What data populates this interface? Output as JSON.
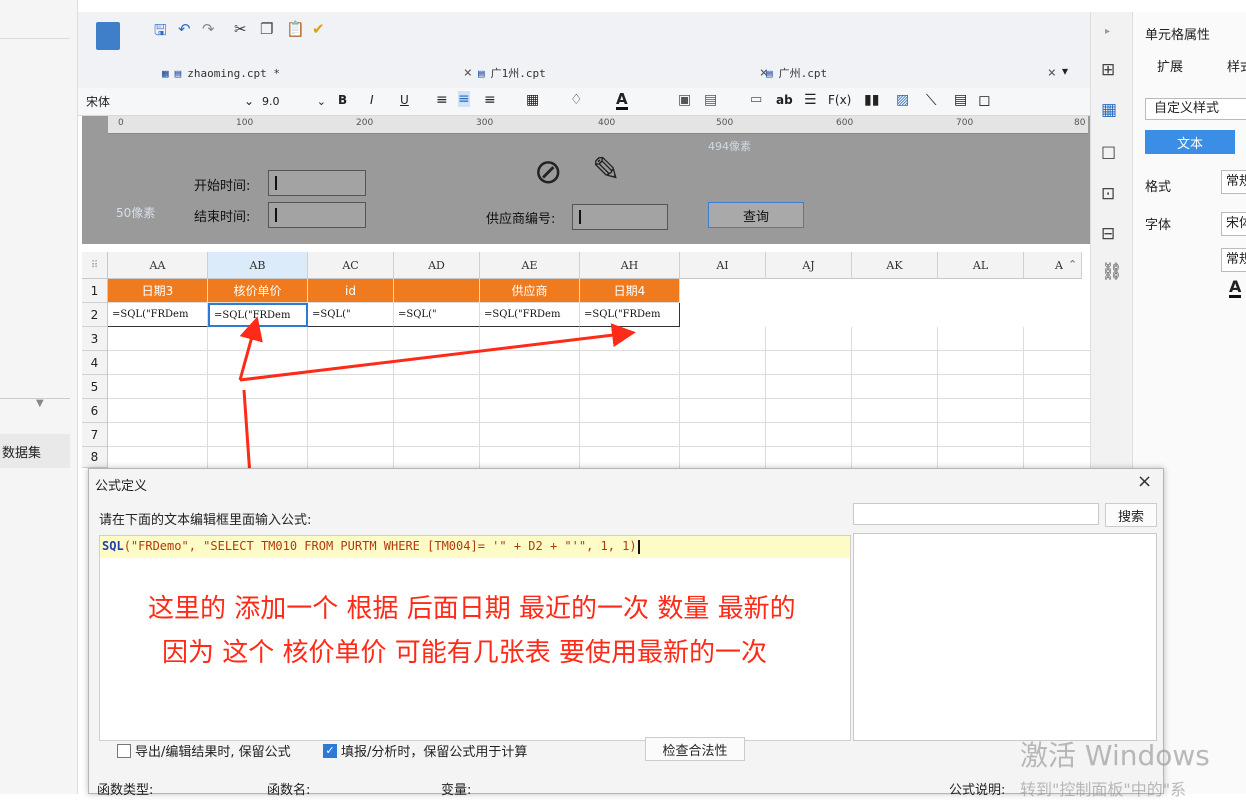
{
  "left_panel": {
    "dataset_label": "数据集"
  },
  "toolbar": {
    "tabs": [
      {
        "icon": "grid-icon",
        "label": "zhaoming.cpt *"
      },
      {
        "label": "广1州.cpt"
      },
      {
        "label": "广州.cpt"
      }
    ],
    "font_name": "宋体",
    "font_size": "9.0"
  },
  "ruler": {
    "ticks": [
      "0",
      "100",
      "200",
      "300",
      "400",
      "500",
      "600",
      "700",
      "80"
    ],
    "width_note": "494像素"
  },
  "param_pane": {
    "start_label": "开始时间:",
    "end_label": "结束时间:",
    "supplier_label": "供应商编号:",
    "query_button": "查询",
    "height_note": "50像素"
  },
  "grid": {
    "columns": [
      "AA",
      "AB",
      "AC",
      "AD",
      "AE",
      "AH",
      "AI",
      "AJ",
      "AK",
      "AL",
      "A"
    ],
    "rows": [
      "1",
      "2",
      "3",
      "4",
      "5",
      "6",
      "7",
      "8"
    ],
    "row1": [
      "日期3",
      "核价单价",
      "id",
      "",
      "供应商",
      "日期4"
    ],
    "row2": [
      "=SQL(\"FRDem",
      "=SQL(\"FRDem",
      "=SQL(\"",
      "=SQL(\"",
      "=SQL(\"FRDem",
      "=SQL(\"FRDem"
    ]
  },
  "props": {
    "title": "单元格属性",
    "tab_expand": "扩展",
    "tab_style": "样式",
    "style_select": "自定义样式",
    "text_tab": "文本",
    "format_label": "格式",
    "format_value": "常规",
    "font_label": "字体",
    "font_value": "宋体",
    "size_value": "常规",
    "font_color_glyph": "A"
  },
  "dialog": {
    "title": "公式定义",
    "close": "×",
    "prompt": "请在下面的文本编辑框里面输入公式:",
    "search_button": "搜索",
    "formula_fn": "SQL",
    "formula_rest": "(\"FRDemo\", \"SELECT TM010 FROM PURTM WHERE [TM004]= '\" + D2 + \"'\", 1, 1)",
    "annotation_line1": "这里的 添加一个 根据 后面日期 最近的一次 数量 最新的",
    "annotation_line2": "因为 这个 核价单价 可能有几张表  要使用最新的一次",
    "checkbox1": "导出/编辑结果时, 保留公式",
    "checkbox2": "填报/分析时，保留公式用于计算",
    "check_button": "检查合法性",
    "footer_type": "函数类型:",
    "footer_name": "函数名:",
    "footer_var": "变量:",
    "footer_desc": "公式说明:"
  },
  "watermark": {
    "line1": "激活 Windows",
    "line2": "转到\"控制面板\"中的\"系"
  },
  "colors": {
    "accent": "#f07b1e",
    "annotation": "#ff2a17",
    "formula_bg": "#fdfcc6"
  }
}
